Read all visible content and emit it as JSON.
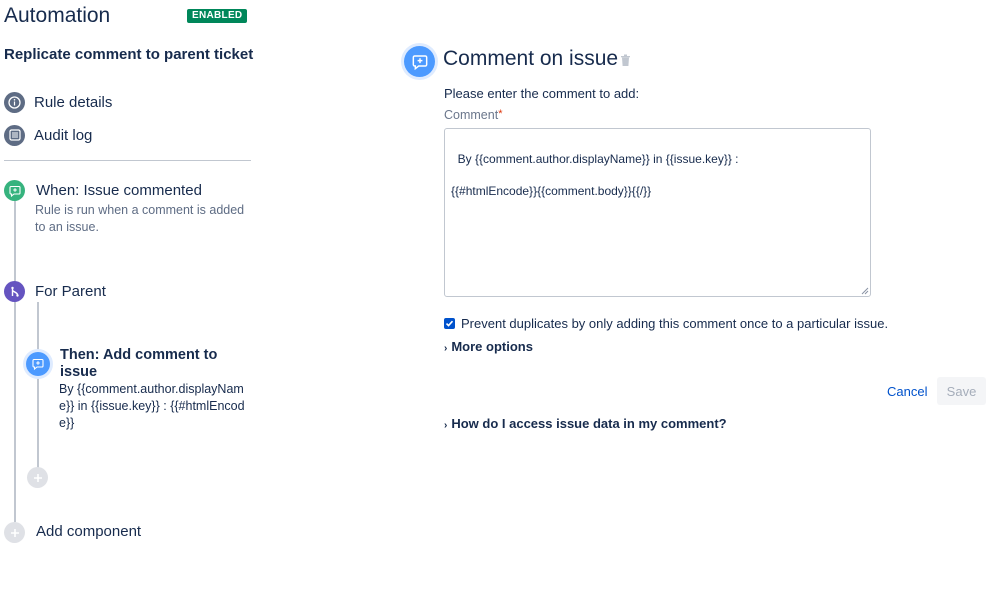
{
  "header": {
    "title": "Automation",
    "status_badge": "ENABLED",
    "rule_name": "Replicate comment to parent ticket"
  },
  "sidebar": {
    "nav": [
      {
        "label": "Rule details",
        "icon": "info-icon"
      },
      {
        "label": "Audit log",
        "icon": "list-icon"
      }
    ]
  },
  "flow": {
    "trigger": {
      "title": "When: Issue commented",
      "description": "Rule is run when a comment is added to an issue.",
      "icon": "comment-icon"
    },
    "branch": {
      "title": "For Parent",
      "icon": "branch-icon"
    },
    "action": {
      "title": "Then: Add comment to issue",
      "description": "By {{comment.author.displayName}} in {{issue.key}} : {{#htmlEncode}}",
      "icon": "comment-icon"
    },
    "add_component": "Add component"
  },
  "panel": {
    "title": "Comment on issue",
    "prompt": "Please enter the comment to add:",
    "field_label": "Comment",
    "required_marker": "*",
    "comment_value": "By {{comment.author.displayName}} in {{issue.key}} :\n\n{{#htmlEncode}}{{comment.body}}{{/}}",
    "prevent_duplicates_label": "Prevent duplicates by only adding this comment once to a particular issue.",
    "prevent_duplicates_checked": true,
    "more_options": "More options",
    "cancel": "Cancel",
    "save": "Save",
    "help_link": "How do I access issue data in my comment?"
  },
  "colors": {
    "brand_blue": "#4c9aff",
    "link_blue": "#0052cc",
    "trigger_green": "#36b37e",
    "branch_purple": "#6554c0",
    "enabled_green": "#00875a"
  }
}
